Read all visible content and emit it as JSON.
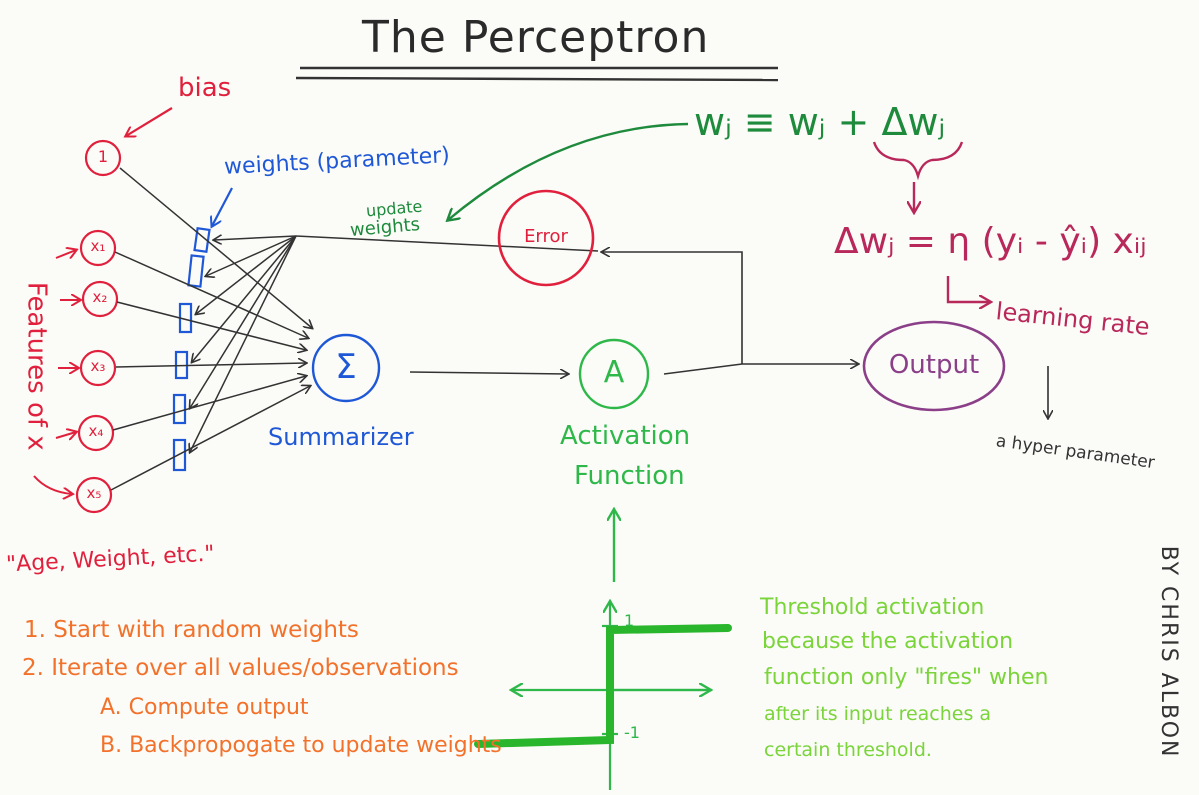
{
  "title": "The Perceptron",
  "labels": {
    "bias": "bias",
    "weights": "weights (parameter)",
    "update_weights_1": "update",
    "update_weights_2": "weights",
    "error": "Error",
    "summarizer": "Summarizer",
    "summarizer_symbol": "Σ",
    "activation_symbol": "A",
    "activation_1": "Activation",
    "activation_2": "Function",
    "output": "Output",
    "features": "Features of x",
    "examples": "\"Age, Weight, etc.\"",
    "bias_node": "1",
    "inputs": [
      "x₁",
      "x₂",
      "x₃",
      "x₄",
      "x₅"
    ]
  },
  "formulas": {
    "update_rule": "wⱼ ≡ wⱼ + Δwⱼ",
    "delta_rule": "Δwⱼ = η (yᵢ - ŷᵢ) xᵢⱼ",
    "learning_rate": "learning rate",
    "hyper_parameter": "a hyper parameter"
  },
  "steps": [
    "1. Start with random weights",
    "2. Iterate over all values/observations",
    "A. Compute output",
    "B. Backpropogate to update weights"
  ],
  "threshold": {
    "tick_pos": "1",
    "tick_neg": "-1",
    "note": [
      "Threshold activation",
      "because the activation",
      "function only \"fires\" when",
      "after its input reaches a",
      "certain threshold."
    ]
  },
  "credit": "BY CHRIS ALBON",
  "colors": {
    "red": "#e0203c",
    "blue": "#1f58d6",
    "dark_green": "#1e8a3c",
    "green": "#2fb84a",
    "light_green": "#7ad43a",
    "orange": "#f2722b",
    "maroon": "#b8285a",
    "purple": "#8b3f88",
    "gray": "#333333"
  }
}
